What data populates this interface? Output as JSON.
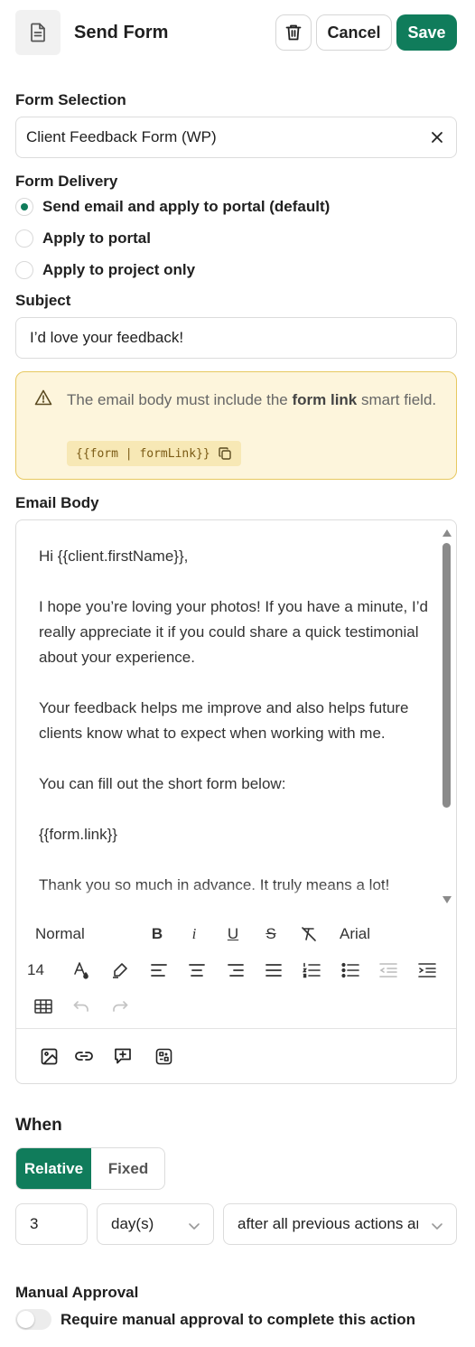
{
  "header": {
    "title": "Send Form",
    "cancel_label": "Cancel",
    "save_label": "Save"
  },
  "form_selection": {
    "label": "Form Selection",
    "value": "Client Feedback Form (WP)"
  },
  "form_delivery": {
    "label": "Form Delivery",
    "options": [
      {
        "label": "Send email and apply to portal (default)",
        "selected": true
      },
      {
        "label": "Apply to portal",
        "selected": false
      },
      {
        "label": "Apply to project only",
        "selected": false
      }
    ]
  },
  "subject": {
    "label": "Subject",
    "value": "I’d love your feedback!"
  },
  "warning": {
    "text_before": "The email body must include the ",
    "text_bold": "form link",
    "text_after": " smart field.",
    "code": "{{form | formLink}}"
  },
  "email_body": {
    "label": "Email Body",
    "paragraphs": [
      "Hi {{client.firstName}},",
      "I hope you’re loving your photos! If you have a minute, I’d really appreciate it if you could share a quick testimonial about your experience.",
      "Your feedback helps me improve and also helps future clients know what to expect when working with me.",
      "You can fill out the short form below:",
      "{{form.link}}",
      "Thank you so much in advance. It truly means a lot!"
    ],
    "toolbar": {
      "paragraph_style": "Normal",
      "bold": "B",
      "italic": "i",
      "underline": "U",
      "strike": "S",
      "font_family": "Arial",
      "font_size": "14"
    }
  },
  "when": {
    "label": "When",
    "relative_label": "Relative",
    "fixed_label": "Fixed",
    "active": "Relative",
    "amount": "3",
    "unit": "day(s)",
    "anchor": "after all previous actions are complete"
  },
  "manual_approval": {
    "label": "Manual Approval",
    "toggle_label": "Require manual approval to complete this action",
    "enabled": false
  },
  "colors": {
    "primary": "#107c5b",
    "warning_bg": "#fdf5dc",
    "warning_border": "#e7c860"
  }
}
